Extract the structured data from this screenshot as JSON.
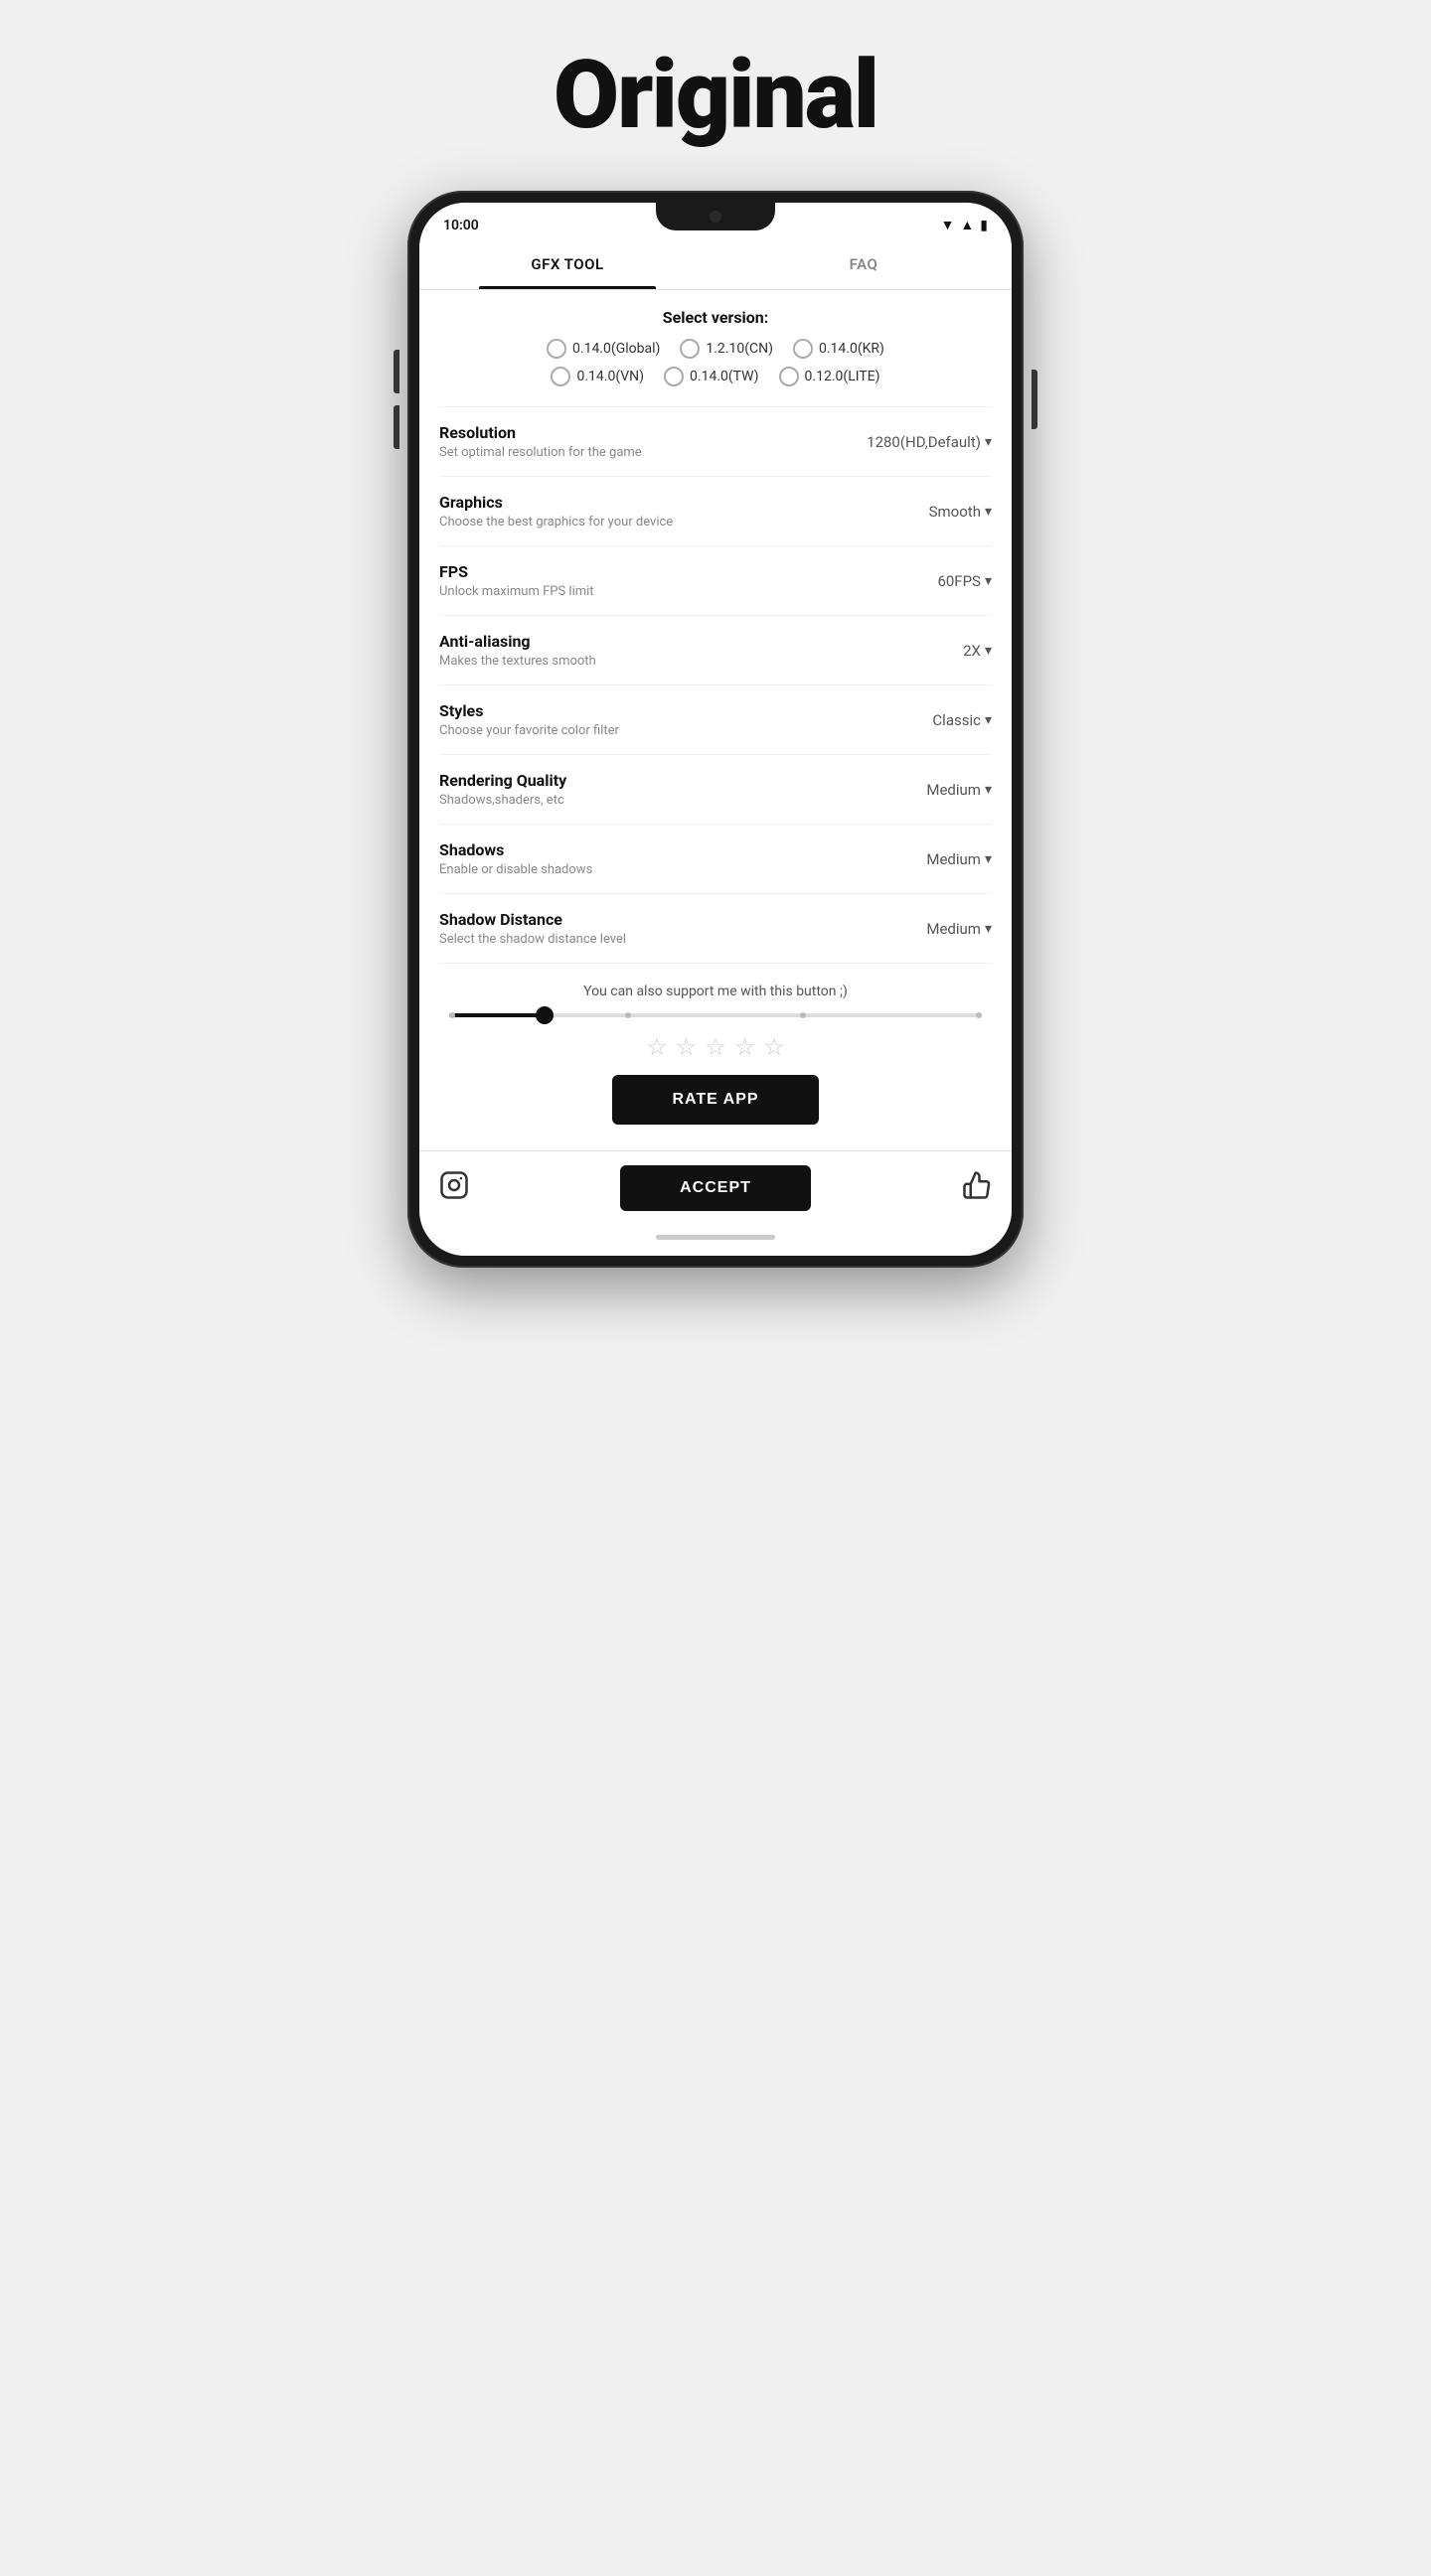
{
  "page": {
    "title": "Original"
  },
  "phone": {
    "status_time": "10:00"
  },
  "tabs": [
    {
      "id": "gfx",
      "label": "GFX TOOL",
      "active": true
    },
    {
      "id": "faq",
      "label": "FAQ",
      "active": false
    }
  ],
  "select_version": {
    "title": "Select version:",
    "options": [
      {
        "label": "0.14.0(Global)"
      },
      {
        "label": "1.2.10(CN)"
      },
      {
        "label": "0.14.0(KR)"
      },
      {
        "label": "0.14.0(VN)"
      },
      {
        "label": "0.14.0(TW)"
      },
      {
        "label": "0.12.0(LITE)"
      }
    ]
  },
  "settings": [
    {
      "id": "resolution",
      "label": "Resolution",
      "desc": "Set optimal resolution for the game",
      "value": "1280(HD,Default)"
    },
    {
      "id": "graphics",
      "label": "Graphics",
      "desc": "Choose the best graphics for your device",
      "value": "Smooth"
    },
    {
      "id": "fps",
      "label": "FPS",
      "desc": "Unlock maximum FPS limit",
      "value": "60FPS"
    },
    {
      "id": "antialiasing",
      "label": "Anti-aliasing",
      "desc": "Makes the textures smooth",
      "value": "2X"
    },
    {
      "id": "styles",
      "label": "Styles",
      "desc": "Choose your favorite color filter",
      "value": "Classic"
    },
    {
      "id": "rendering_quality",
      "label": "Rendering Quality",
      "desc": "Shadows,shaders, etc",
      "value": "Medium"
    },
    {
      "id": "shadows",
      "label": "Shadows",
      "desc": "Enable or disable shadows",
      "value": "Medium"
    },
    {
      "id": "shadow_distance",
      "label": "Shadow Distance",
      "desc": "Select the shadow distance level",
      "value": "Medium"
    }
  ],
  "support": {
    "text": "You can also support me with this button ;)",
    "stars": [
      "★",
      "★",
      "★",
      "★",
      "★"
    ],
    "rate_label": "RATE APP",
    "accept_label": "ACCEPT"
  }
}
